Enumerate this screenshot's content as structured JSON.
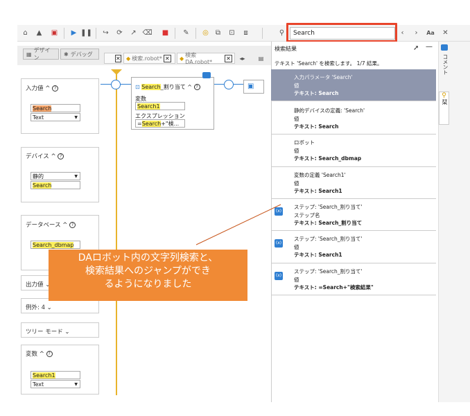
{
  "search": {
    "value": "Search"
  },
  "toolbar": {
    "font_toggle": "Aa"
  },
  "tabs": {
    "design": "デザイン",
    "debug": "デバッグ",
    "file1": "検索.robot*",
    "file2": "検索DA.robot*"
  },
  "left": {
    "input": {
      "title": "入力値",
      "value": "Search",
      "type": "Text"
    },
    "device": {
      "title": "デバイス",
      "kind": "静的",
      "value": "Search"
    },
    "database": {
      "title": "データベース",
      "value": "Search_dbmap"
    },
    "output": {
      "title": "出力値"
    },
    "exceptions": {
      "title": "例外: 4"
    },
    "treemode": {
      "title": "ツリー モード"
    },
    "variables": {
      "title": "変数",
      "value": "Search1",
      "type": "Text"
    }
  },
  "node": {
    "title_hl": "Search",
    "title_rest": "_割り当て",
    "var_label": "変数",
    "var_value": "Search1",
    "expr_label": "エクスプレッション",
    "expr_prefix": "=",
    "expr_hl": "Search",
    "expr_rest": "+\"検..."
  },
  "results": {
    "title": "検索結果",
    "summary": "テキスト 'Search' を検索します。 1/7 結果。",
    "items": [
      {
        "l1": "入力パラメータ 'Search'",
        "l2": "値",
        "l3": "テキスト: Search"
      },
      {
        "l1": "静的デバイスの定義: 'Search'",
        "l2": "値",
        "l3": "テキスト: Search"
      },
      {
        "l1": "ロボット",
        "l2": "値",
        "l3": "テキスト: Search_dbmap"
      },
      {
        "l1": "変数の定義 'Search1'",
        "l2": "値",
        "l3": "テキスト: Search1"
      },
      {
        "l1": "ステップ: 'Search_割り当て'",
        "l2": "ステップ名",
        "l3": "テキスト: Search_割り当て"
      },
      {
        "l1": "ステップ: 'Search_割り当て'",
        "l2": "値",
        "l3": "テキスト: Search1"
      },
      {
        "l1": "ステップ: 'Search_割り当て'",
        "l2": "値",
        "l3": "テキスト: =Search+\"検索結果\""
      }
    ]
  },
  "sidebar": {
    "comment": "コメント",
    "bookmark": "栞"
  },
  "callout": {
    "line1": "DAロボット内の文字列検索と、",
    "line2": "検索結果へのジャンプができ",
    "line3": "るようになりました"
  }
}
